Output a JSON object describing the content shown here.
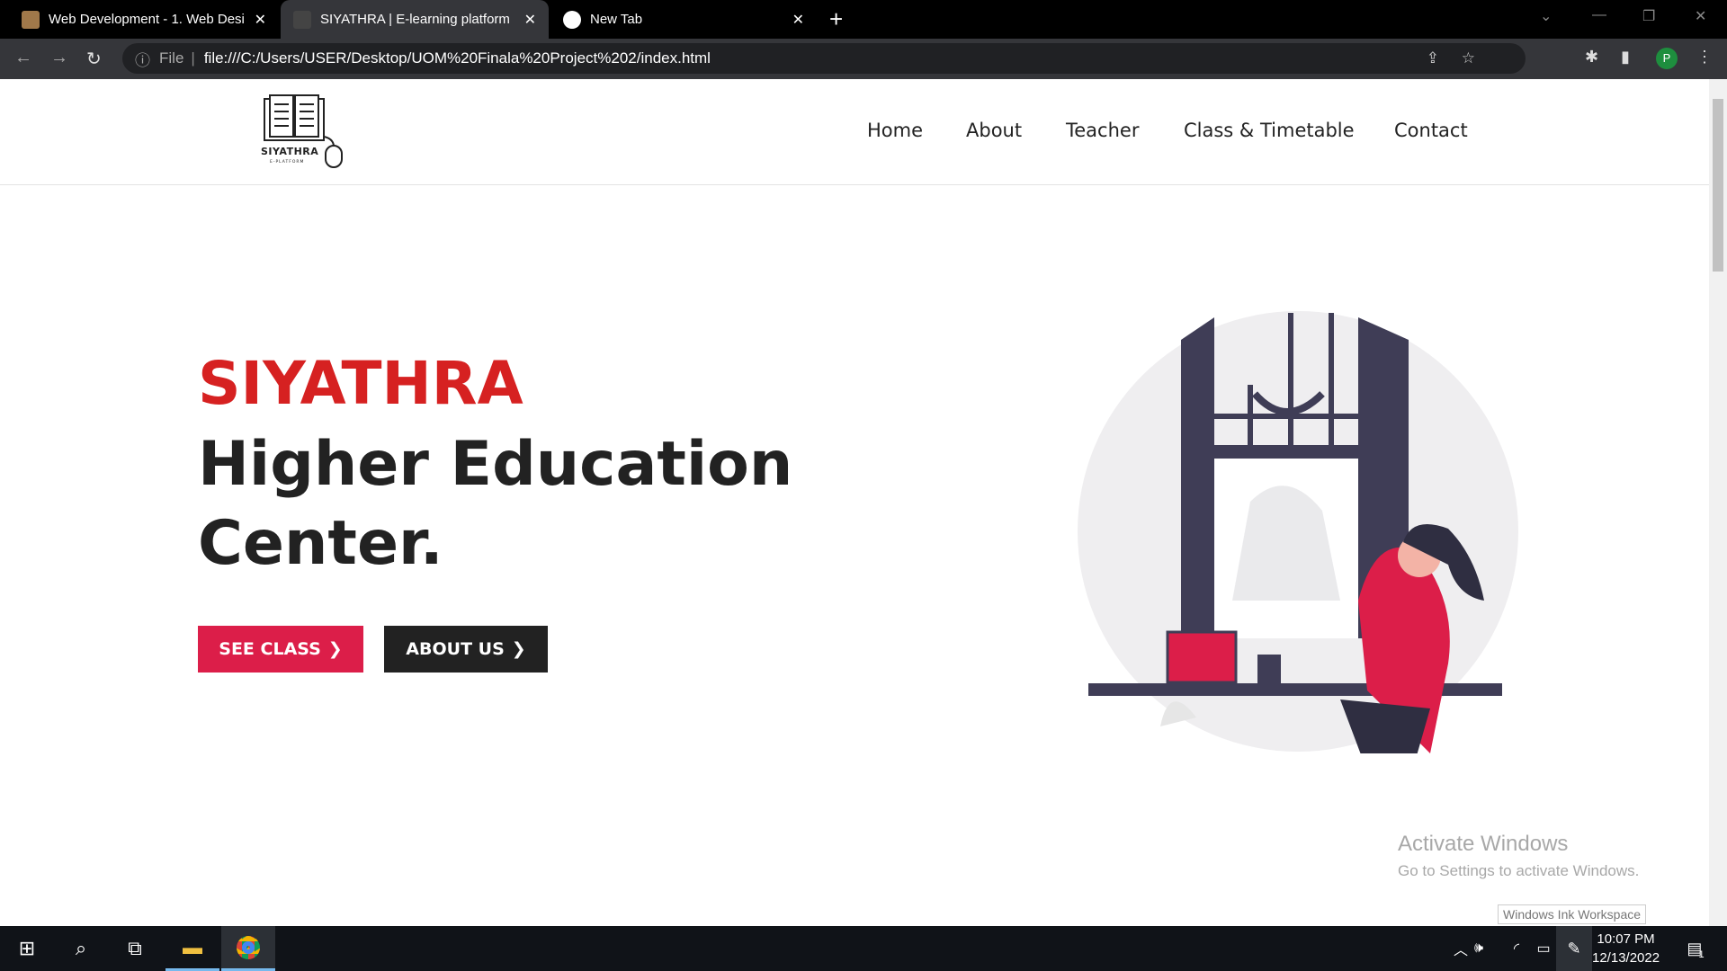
{
  "browser": {
    "tabs": [
      {
        "label": "Web Development - 1. Web Desi",
        "active": false
      },
      {
        "label": "SIYATHRA | E-learning platform",
        "active": true
      },
      {
        "label": "New Tab",
        "active": false
      }
    ],
    "url_scheme_label": "File",
    "url": "file:///C:/Users/USER/Desktop/UOM%20Finala%20Project%202/index.html",
    "profile_initial": "P"
  },
  "site": {
    "logo_text": "SIYATHRA",
    "logo_subtext": "E-PLATFORM",
    "nav": [
      "Home",
      "About",
      "Teacher",
      "Class & Timetable",
      "Contact"
    ],
    "hero": {
      "brand": "SIYATHRA",
      "headline_line1": "Higher Education",
      "headline_line2": "Center.",
      "buttons": [
        {
          "label": "SEE CLASS"
        },
        {
          "label": "ABOUT US"
        }
      ]
    },
    "colors": {
      "accent": "#dc1e49",
      "brand_red": "#d62121",
      "dark": "#222222"
    }
  },
  "watermark": {
    "title": "Activate Windows",
    "subtitle": "Go to Settings to activate Windows."
  },
  "tooltip": "Windows Ink Workspace",
  "taskbar": {
    "time": "10:07 PM",
    "date": "12/13/2022",
    "notifications": "1"
  }
}
